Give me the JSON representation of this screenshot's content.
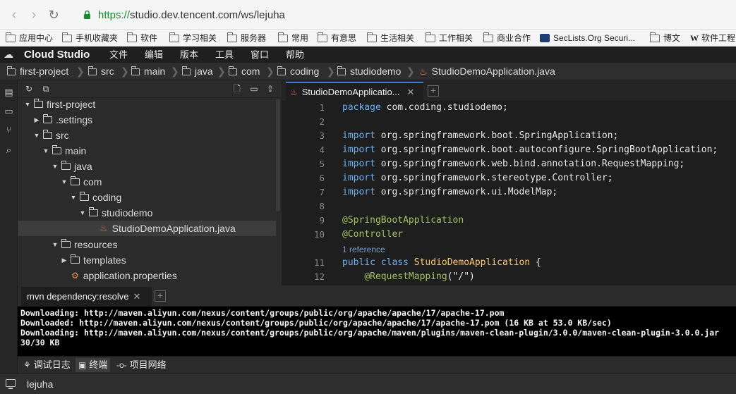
{
  "browser": {
    "url_scheme": "https://",
    "url_rest": "studio.dev.tencent.com/ws/lejuha",
    "bookmarks": [
      "应用中心",
      "手机收藏夹",
      "软件",
      "学习相关",
      "服务器",
      "常用",
      "有意思",
      "生活相关",
      "工作相关",
      "商业合作",
      "SecLists.Org Securi...",
      "博文",
      "软件工程"
    ]
  },
  "ide": {
    "title": "Cloud Studio",
    "menu": [
      "文件",
      "编辑",
      "版本",
      "工具",
      "窗口",
      "帮助"
    ],
    "breadcrumb": [
      "first-project",
      "src",
      "main",
      "java",
      "com",
      "coding",
      "studiodemo",
      "StudioDemoApplication.java"
    ]
  },
  "tree": {
    "items": [
      {
        "label": "first-project"
      },
      {
        "label": ".settings"
      },
      {
        "label": "src"
      },
      {
        "label": "main"
      },
      {
        "label": "java"
      },
      {
        "label": "com"
      },
      {
        "label": "coding"
      },
      {
        "label": "studiodemo"
      },
      {
        "label": "StudioDemoApplication.java"
      },
      {
        "label": "resources"
      },
      {
        "label": "templates"
      },
      {
        "label": "application.properties"
      }
    ]
  },
  "editor": {
    "tab_label": "StudioDemoApplicatio...",
    "codelens": "1 reference",
    "lines": [
      {
        "n": "1",
        "text": "package com.coding.studiodemo;"
      },
      {
        "n": "2",
        "text": ""
      },
      {
        "n": "3",
        "text": "import org.springframework.boot.SpringApplication;"
      },
      {
        "n": "4",
        "text": "import org.springframework.boot.autoconfigure.SpringBootApplication;"
      },
      {
        "n": "5",
        "text": "import org.springframework.web.bind.annotation.RequestMapping;"
      },
      {
        "n": "6",
        "text": "import org.springframework.stereotype.Controller;"
      },
      {
        "n": "7",
        "text": "import org.springframework.ui.ModelMap;"
      },
      {
        "n": "8",
        "text": ""
      },
      {
        "n": "9",
        "text": "@SpringBootApplication"
      },
      {
        "n": "10",
        "text": "@Controller"
      },
      {
        "n": "11",
        "text": "public class StudioDemoApplication {"
      },
      {
        "n": "12",
        "text": "    @RequestMapping(\"/\")"
      }
    ]
  },
  "terminal": {
    "tab_label": "mvn dependency:resolve",
    "lines": [
      "Downloading: http://maven.aliyun.com/nexus/content/groups/public/org/apache/apache/17/apache-17.pom",
      "Downloaded: http://maven.aliyun.com/nexus/content/groups/public/org/apache/apache/17/apache-17.pom (16 KB at 53.0 KB/sec)",
      "Downloading: http://maven.aliyun.com/nexus/content/groups/public/org/apache/maven/plugins/maven-clean-plugin/3.0.0/maven-clean-plugin-3.0.0.jar",
      "30/30 KB"
    ]
  },
  "panels": {
    "debug_log": "调试日志",
    "terminal": "终端",
    "network": "项目网络"
  },
  "status": {
    "workspace": "lejuha"
  }
}
